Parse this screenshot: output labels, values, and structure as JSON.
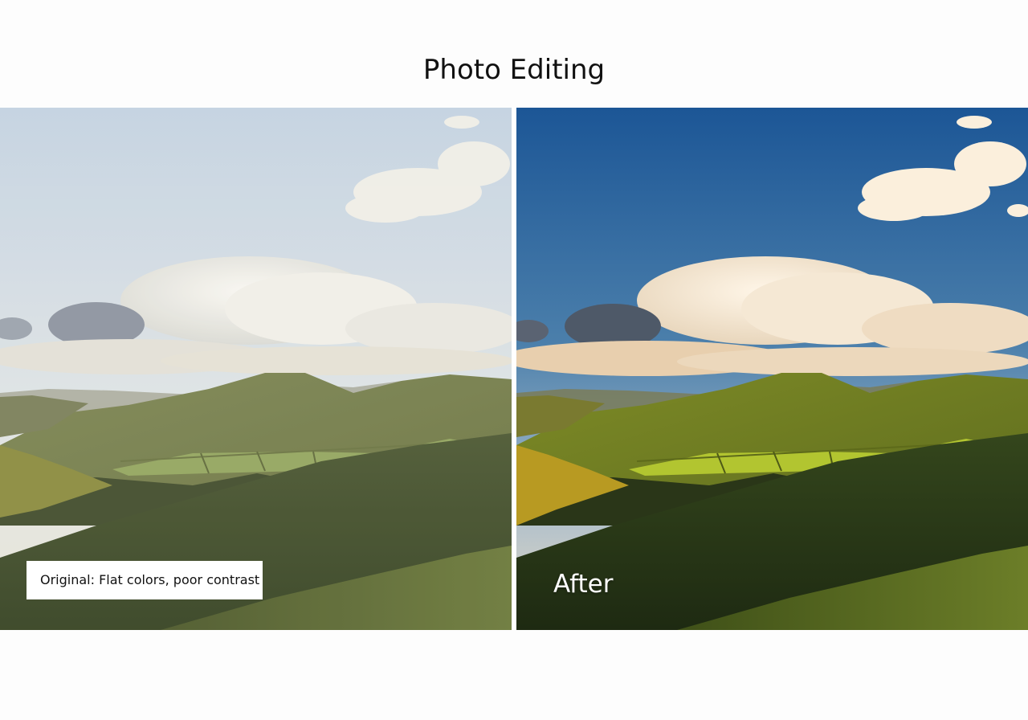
{
  "page": {
    "title": "Photo Editing"
  },
  "before_panel": {
    "caption": "Original: Flat colors, poor contrast",
    "palette": {
      "sky_top": "#c9d7e6",
      "sky_bottom": "#eceae2",
      "haze_hills": "#8a8a78",
      "main_hill": "#6f7a48",
      "fields": "#8ea25a",
      "slope_dark": "#3e4a26",
      "slope_front": "#55622f",
      "clouds": "#f4f2ec"
    }
  },
  "after_panel": {
    "label": "After",
    "palette": {
      "sky_top": "#1f5a96",
      "sky_bottom": "#8fb0c8",
      "haze_hills": "#7b7a52",
      "main_hill": "#6e7a22",
      "fields": "#a8bd2e",
      "slope_dark": "#28361a",
      "slope_front": "#4b5e1e",
      "clouds": "#fbf1e2"
    }
  }
}
